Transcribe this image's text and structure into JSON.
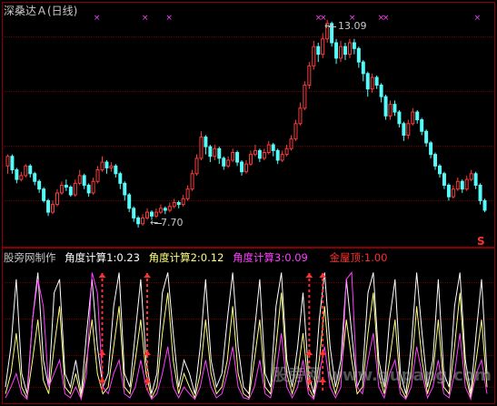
{
  "chart": {
    "title": "深桑达Ａ(日线)",
    "high_label": "13.09",
    "low_label": "7.70",
    "arrow_left": "←",
    "sell_signal_glyph": "S"
  },
  "indicator": {
    "name": "股旁网制作",
    "angle1": "角度计算1:0.23",
    "angle2": "角度计算2:0.12",
    "angle3": "角度计算3:0.09",
    "gold_top": "金屋顶:1.00"
  },
  "watermark": "股旁网 www.gupang.com",
  "colors": {
    "up": "#ff3b3b",
    "down": "#54fcfc",
    "frame": "#8a0000",
    "angle1": "#ffffff",
    "angle2": "#ffff80",
    "angle3": "#ff40ff",
    "gold_top": "#ff3030"
  },
  "chart_data": {
    "type": "candlestick",
    "price_min_shown": 7.7,
    "price_max_shown": 13.09,
    "candles": [
      [
        9.3,
        9.55,
        9.6,
        9.1
      ],
      [
        9.55,
        9.2,
        9.6,
        9.1
      ],
      [
        9.2,
        8.95,
        9.25,
        8.85
      ],
      [
        8.95,
        9.05,
        9.15,
        8.9
      ],
      [
        9.05,
        9.3,
        9.35,
        9.0
      ],
      [
        9.3,
        9.1,
        9.35,
        9.0
      ],
      [
        9.1,
        8.9,
        9.15,
        8.8
      ],
      [
        8.9,
        8.7,
        8.95,
        8.6
      ],
      [
        8.7,
        8.4,
        8.75,
        8.35
      ],
      [
        8.4,
        8.1,
        8.45,
        8.0
      ],
      [
        8.1,
        8.3,
        8.4,
        8.05
      ],
      [
        8.3,
        8.6,
        8.7,
        8.25
      ],
      [
        8.6,
        8.8,
        8.9,
        8.55
      ],
      [
        8.8,
        8.75,
        8.95,
        8.65
      ],
      [
        8.75,
        8.55,
        8.8,
        8.5
      ],
      [
        8.55,
        8.85,
        8.95,
        8.5
      ],
      [
        8.85,
        9.05,
        9.2,
        8.8
      ],
      [
        9.05,
        8.8,
        9.1,
        8.7
      ],
      [
        8.8,
        8.6,
        8.85,
        8.5
      ],
      [
        8.6,
        8.9,
        9.0,
        8.55
      ],
      [
        8.9,
        9.2,
        9.3,
        8.85
      ],
      [
        9.2,
        9.4,
        9.55,
        9.15
      ],
      [
        9.4,
        9.25,
        9.45,
        9.1
      ],
      [
        9.25,
        9.3,
        9.4,
        9.15
      ],
      [
        9.3,
        9.1,
        9.35,
        9.0
      ],
      [
        9.1,
        8.85,
        9.15,
        8.7
      ],
      [
        8.85,
        8.55,
        8.9,
        8.4
      ],
      [
        8.55,
        8.2,
        8.6,
        8.1
      ],
      [
        8.2,
        7.95,
        8.25,
        7.85
      ],
      [
        7.95,
        7.8,
        8.0,
        7.7
      ],
      [
        7.8,
        7.95,
        8.05,
        7.75
      ],
      [
        7.95,
        8.1,
        8.2,
        7.9
      ],
      [
        8.1,
        8.0,
        8.15,
        7.9
      ],
      [
        8.0,
        8.1,
        8.2,
        7.95
      ],
      [
        8.1,
        8.2,
        8.3,
        8.05
      ],
      [
        8.2,
        8.15,
        8.25,
        8.05
      ],
      [
        8.15,
        8.25,
        8.35,
        8.1
      ],
      [
        8.25,
        8.35,
        8.45,
        8.2
      ],
      [
        8.35,
        8.3,
        8.4,
        8.2
      ],
      [
        8.3,
        8.45,
        8.55,
        8.25
      ],
      [
        8.45,
        8.7,
        8.8,
        8.4
      ],
      [
        8.7,
        9.1,
        9.2,
        8.65
      ],
      [
        9.1,
        9.5,
        9.6,
        9.05
      ],
      [
        9.5,
        10.05,
        10.2,
        9.45
      ],
      [
        10.05,
        9.8,
        10.1,
        9.6
      ],
      [
        9.8,
        9.55,
        9.85,
        9.4
      ],
      [
        9.55,
        9.75,
        9.85,
        9.45
      ],
      [
        9.75,
        9.5,
        9.8,
        9.35
      ],
      [
        9.5,
        9.3,
        9.55,
        9.2
      ],
      [
        9.3,
        9.45,
        9.55,
        9.25
      ],
      [
        9.45,
        9.65,
        9.75,
        9.4
      ],
      [
        9.65,
        9.4,
        9.7,
        9.3
      ],
      [
        9.4,
        9.15,
        9.45,
        9.05
      ],
      [
        9.15,
        9.35,
        9.45,
        9.1
      ],
      [
        9.35,
        9.6,
        9.7,
        9.3
      ],
      [
        9.6,
        9.7,
        9.85,
        9.55
      ],
      [
        9.7,
        9.5,
        9.75,
        9.4
      ],
      [
        9.5,
        9.65,
        9.75,
        9.45
      ],
      [
        9.65,
        9.85,
        9.95,
        9.6
      ],
      [
        9.85,
        9.7,
        9.9,
        9.55
      ],
      [
        9.7,
        9.45,
        9.75,
        9.35
      ],
      [
        9.45,
        9.6,
        9.7,
        9.4
      ],
      [
        9.6,
        9.75,
        9.85,
        9.55
      ],
      [
        9.75,
        10.0,
        10.1,
        9.7
      ],
      [
        10.0,
        10.4,
        10.5,
        9.95
      ],
      [
        10.4,
        10.8,
        10.95,
        10.35
      ],
      [
        10.8,
        11.4,
        11.5,
        10.75
      ],
      [
        11.4,
        11.9,
        12.0,
        11.3
      ],
      [
        11.9,
        12.4,
        12.55,
        11.8
      ],
      [
        12.4,
        12.2,
        12.5,
        12.0
      ],
      [
        12.2,
        12.6,
        12.75,
        12.1
      ],
      [
        12.6,
        13.0,
        13.09,
        12.5
      ],
      [
        13.0,
        12.5,
        13.05,
        12.4
      ],
      [
        12.5,
        12.1,
        12.6,
        11.95
      ],
      [
        12.1,
        12.4,
        12.55,
        12.0
      ],
      [
        12.4,
        12.2,
        12.5,
        12.05
      ],
      [
        12.2,
        12.5,
        12.6,
        12.1
      ],
      [
        12.5,
        12.35,
        12.6,
        12.2
      ],
      [
        12.35,
        12.0,
        12.4,
        11.85
      ],
      [
        12.0,
        11.7,
        12.05,
        11.5
      ],
      [
        11.7,
        11.3,
        11.75,
        11.1
      ],
      [
        11.3,
        11.6,
        11.7,
        11.2
      ],
      [
        11.6,
        11.4,
        11.65,
        11.3
      ],
      [
        11.4,
        11.1,
        11.45,
        10.95
      ],
      [
        11.1,
        10.6,
        11.15,
        10.5
      ],
      [
        10.6,
        10.9,
        11.0,
        10.5
      ],
      [
        10.9,
        10.7,
        11.0,
        10.6
      ],
      [
        10.7,
        10.4,
        10.75,
        10.3
      ],
      [
        10.4,
        10.1,
        10.45,
        9.95
      ],
      [
        10.1,
        10.4,
        10.5,
        10.0
      ],
      [
        10.4,
        10.7,
        10.8,
        10.35
      ],
      [
        10.7,
        10.5,
        10.75,
        10.4
      ],
      [
        10.5,
        10.2,
        10.55,
        10.1
      ],
      [
        10.2,
        9.9,
        10.25,
        9.8
      ],
      [
        9.9,
        9.6,
        9.95,
        9.5
      ],
      [
        9.6,
        9.3,
        9.65,
        9.2
      ],
      [
        9.3,
        9.1,
        9.35,
        9.0
      ],
      [
        9.1,
        8.8,
        9.15,
        8.7
      ],
      [
        8.8,
        8.5,
        8.85,
        8.4
      ],
      [
        8.5,
        8.7,
        8.8,
        8.45
      ],
      [
        8.7,
        8.9,
        9.0,
        8.65
      ],
      [
        8.9,
        8.7,
        8.95,
        8.6
      ],
      [
        8.7,
        8.95,
        9.05,
        8.65
      ],
      [
        8.95,
        9.1,
        9.2,
        8.9
      ],
      [
        9.1,
        8.8,
        9.15,
        8.7
      ],
      [
        8.8,
        8.4,
        8.85,
        8.3
      ],
      [
        8.4,
        8.15,
        8.45,
        8.1
      ]
    ],
    "indicator_series": [
      {
        "name": "角度计算1",
        "color": "#ffffff",
        "values": [
          0.1,
          0.4,
          0.9,
          0.2,
          0.05,
          0.6,
          0.95,
          0.3,
          0.1,
          0.8,
          0.9,
          0.2,
          0.1,
          0.3,
          0.05,
          0.5,
          0.9,
          0.4,
          0.1,
          0.2,
          0.7,
          0.95,
          0.2,
          0.1,
          0.5,
          0.9,
          0.3,
          0.05,
          0.2,
          0.8,
          0.95,
          0.5,
          0.1,
          0.3,
          0.2,
          0.05,
          0.4,
          0.9,
          0.3,
          0.1,
          0.2,
          0.6,
          0.95,
          0.4,
          0.1,
          0.05,
          0.5,
          0.9,
          0.2,
          0.1,
          0.7,
          0.95,
          0.3,
          0.1,
          0.4,
          0.8,
          0.2,
          0.05,
          0.6,
          0.95,
          0.4,
          0.1,
          0.3,
          0.9,
          0.5,
          0.1,
          0.2,
          0.8,
          0.95,
          0.3,
          0.1,
          0.6,
          0.9,
          0.2,
          0.05,
          0.4,
          0.95,
          0.5,
          0.1,
          0.3,
          0.9,
          0.2,
          0.1,
          0.7,
          0.95,
          0.3,
          0.05,
          0.5,
          0.9,
          0.2
        ]
      },
      {
        "name": "角度计算2",
        "color": "#ffff80",
        "values": [
          0.05,
          0.2,
          0.5,
          0.1,
          0.02,
          0.3,
          0.6,
          0.15,
          0.05,
          0.4,
          0.7,
          0.1,
          0.05,
          0.2,
          0.02,
          0.3,
          0.6,
          0.2,
          0.05,
          0.1,
          0.4,
          0.7,
          0.1,
          0.05,
          0.3,
          0.6,
          0.2,
          0.02,
          0.1,
          0.5,
          0.8,
          0.3,
          0.05,
          0.2,
          0.1,
          0.02,
          0.2,
          0.6,
          0.2,
          0.05,
          0.1,
          0.3,
          0.7,
          0.2,
          0.05,
          0.02,
          0.3,
          0.6,
          0.1,
          0.05,
          0.4,
          0.8,
          0.2,
          0.05,
          0.2,
          0.5,
          0.1,
          0.02,
          0.3,
          0.7,
          0.2,
          0.05,
          0.2,
          0.6,
          0.3,
          0.05,
          0.1,
          0.5,
          0.8,
          0.2,
          0.05,
          0.3,
          0.6,
          0.1,
          0.02,
          0.2,
          0.7,
          0.3,
          0.05,
          0.2,
          0.6,
          0.1,
          0.05,
          0.4,
          0.8,
          0.2,
          0.02,
          0.3,
          0.6,
          0.1
        ]
      },
      {
        "name": "角度计算3",
        "color": "#ff40ff",
        "values": [
          0.02,
          0.1,
          0.2,
          0.05,
          0.01,
          0.6,
          0.9,
          0.7,
          0.1,
          0.2,
          0.3,
          0.05,
          0.02,
          0.1,
          0.01,
          0.2,
          0.95,
          0.8,
          0.1,
          0.05,
          0.2,
          0.3,
          0.05,
          0.02,
          0.1,
          0.3,
          0.1,
          0.01,
          0.05,
          0.2,
          0.4,
          0.1,
          0.02,
          0.1,
          0.05,
          0.01,
          0.1,
          0.3,
          0.1,
          0.02,
          0.05,
          0.2,
          0.4,
          0.1,
          0.02,
          0.01,
          0.1,
          0.3,
          0.05,
          0.02,
          0.2,
          0.5,
          0.1,
          0.02,
          0.1,
          0.3,
          0.05,
          0.01,
          0.2,
          0.4,
          0.1,
          0.02,
          0.1,
          0.9,
          0.95,
          0.1,
          0.05,
          0.3,
          0.5,
          0.1,
          0.02,
          0.2,
          0.3,
          0.05,
          0.01,
          0.1,
          0.4,
          0.2,
          0.02,
          0.1,
          0.3,
          0.05,
          0.02,
          0.2,
          0.5,
          0.1,
          0.01,
          0.2,
          0.3,
          0.05
        ]
      }
    ],
    "gold_top_signal_indices": [
      21,
      31,
      67,
      70
    ]
  }
}
